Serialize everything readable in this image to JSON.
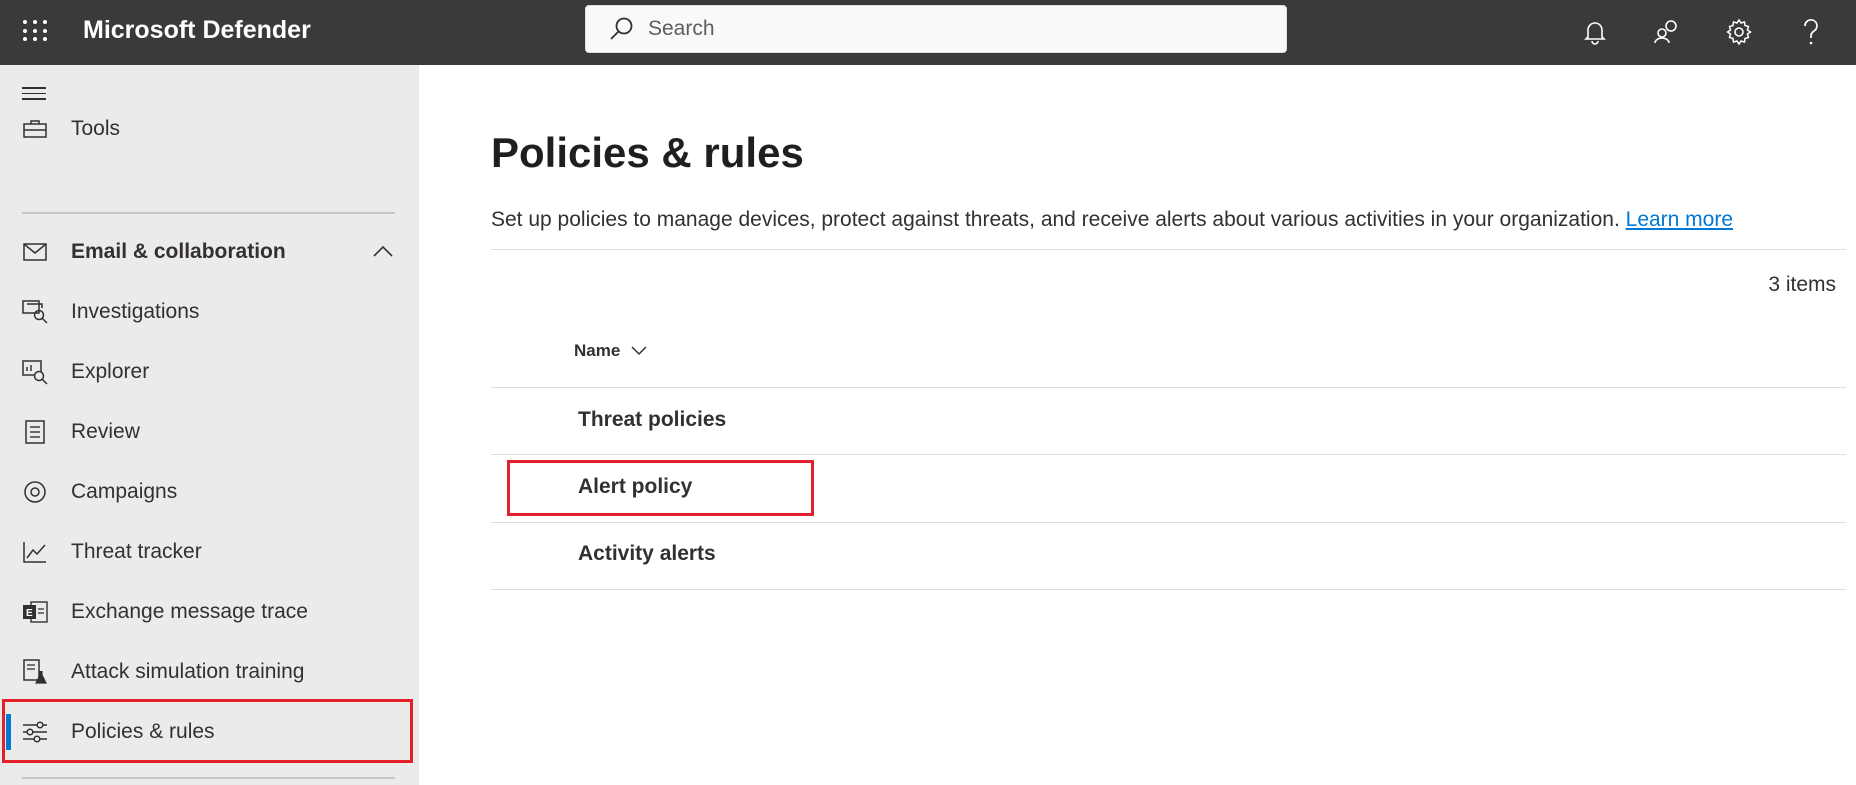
{
  "app": {
    "title": "Microsoft Defender"
  },
  "search": {
    "placeholder": "Search"
  },
  "topbar": {
    "icons": [
      "bell-icon",
      "people-icon",
      "gear-icon",
      "help-icon"
    ]
  },
  "sidebar": {
    "items": [
      {
        "label": "Tools",
        "icon": "toolbox-icon"
      },
      {
        "label": "Email & collaboration",
        "icon": "mail-icon",
        "expanded": true
      },
      {
        "label": "Investigations",
        "icon": "investigation-icon"
      },
      {
        "label": "Explorer",
        "icon": "explorer-icon"
      },
      {
        "label": "Review",
        "icon": "review-icon"
      },
      {
        "label": "Campaigns",
        "icon": "target-icon"
      },
      {
        "label": "Threat tracker",
        "icon": "chart-icon"
      },
      {
        "label": "Exchange message trace",
        "icon": "exchange-icon"
      },
      {
        "label": "Attack simulation training",
        "icon": "simulation-icon"
      },
      {
        "label": "Policies & rules",
        "icon": "sliders-icon",
        "active": true
      }
    ]
  },
  "main": {
    "title": "Policies & rules",
    "description": "Set up policies to manage devices, protect against threats, and receive alerts about various activities in your organization.",
    "learn_more": "Learn more",
    "count": "3 items",
    "column_header": "Name",
    "rows": [
      {
        "name": "Threat policies"
      },
      {
        "name": "Alert policy"
      },
      {
        "name": "Activity alerts"
      }
    ]
  },
  "colors": {
    "topbar": "#3b3a39",
    "sidebar": "#edebe9",
    "accent": "#0078d4",
    "highlight": "#e3202b"
  }
}
